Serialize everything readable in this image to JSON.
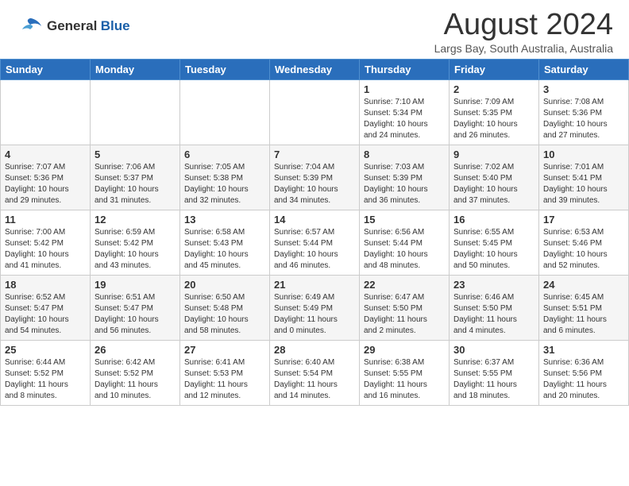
{
  "header": {
    "logo_general": "General",
    "logo_blue": "Blue",
    "month_title": "August 2024",
    "location": "Largs Bay, South Australia, Australia"
  },
  "weekdays": [
    "Sunday",
    "Monday",
    "Tuesday",
    "Wednesday",
    "Thursday",
    "Friday",
    "Saturday"
  ],
  "weeks": [
    [
      {
        "day": "",
        "info": ""
      },
      {
        "day": "",
        "info": ""
      },
      {
        "day": "",
        "info": ""
      },
      {
        "day": "",
        "info": ""
      },
      {
        "day": "1",
        "info": "Sunrise: 7:10 AM\nSunset: 5:34 PM\nDaylight: 10 hours\nand 24 minutes."
      },
      {
        "day": "2",
        "info": "Sunrise: 7:09 AM\nSunset: 5:35 PM\nDaylight: 10 hours\nand 26 minutes."
      },
      {
        "day": "3",
        "info": "Sunrise: 7:08 AM\nSunset: 5:36 PM\nDaylight: 10 hours\nand 27 minutes."
      }
    ],
    [
      {
        "day": "4",
        "info": "Sunrise: 7:07 AM\nSunset: 5:36 PM\nDaylight: 10 hours\nand 29 minutes."
      },
      {
        "day": "5",
        "info": "Sunrise: 7:06 AM\nSunset: 5:37 PM\nDaylight: 10 hours\nand 31 minutes."
      },
      {
        "day": "6",
        "info": "Sunrise: 7:05 AM\nSunset: 5:38 PM\nDaylight: 10 hours\nand 32 minutes."
      },
      {
        "day": "7",
        "info": "Sunrise: 7:04 AM\nSunset: 5:39 PM\nDaylight: 10 hours\nand 34 minutes."
      },
      {
        "day": "8",
        "info": "Sunrise: 7:03 AM\nSunset: 5:39 PM\nDaylight: 10 hours\nand 36 minutes."
      },
      {
        "day": "9",
        "info": "Sunrise: 7:02 AM\nSunset: 5:40 PM\nDaylight: 10 hours\nand 37 minutes."
      },
      {
        "day": "10",
        "info": "Sunrise: 7:01 AM\nSunset: 5:41 PM\nDaylight: 10 hours\nand 39 minutes."
      }
    ],
    [
      {
        "day": "11",
        "info": "Sunrise: 7:00 AM\nSunset: 5:42 PM\nDaylight: 10 hours\nand 41 minutes."
      },
      {
        "day": "12",
        "info": "Sunrise: 6:59 AM\nSunset: 5:42 PM\nDaylight: 10 hours\nand 43 minutes."
      },
      {
        "day": "13",
        "info": "Sunrise: 6:58 AM\nSunset: 5:43 PM\nDaylight: 10 hours\nand 45 minutes."
      },
      {
        "day": "14",
        "info": "Sunrise: 6:57 AM\nSunset: 5:44 PM\nDaylight: 10 hours\nand 46 minutes."
      },
      {
        "day": "15",
        "info": "Sunrise: 6:56 AM\nSunset: 5:44 PM\nDaylight: 10 hours\nand 48 minutes."
      },
      {
        "day": "16",
        "info": "Sunrise: 6:55 AM\nSunset: 5:45 PM\nDaylight: 10 hours\nand 50 minutes."
      },
      {
        "day": "17",
        "info": "Sunrise: 6:53 AM\nSunset: 5:46 PM\nDaylight: 10 hours\nand 52 minutes."
      }
    ],
    [
      {
        "day": "18",
        "info": "Sunrise: 6:52 AM\nSunset: 5:47 PM\nDaylight: 10 hours\nand 54 minutes."
      },
      {
        "day": "19",
        "info": "Sunrise: 6:51 AM\nSunset: 5:47 PM\nDaylight: 10 hours\nand 56 minutes."
      },
      {
        "day": "20",
        "info": "Sunrise: 6:50 AM\nSunset: 5:48 PM\nDaylight: 10 hours\nand 58 minutes."
      },
      {
        "day": "21",
        "info": "Sunrise: 6:49 AM\nSunset: 5:49 PM\nDaylight: 11 hours\nand 0 minutes."
      },
      {
        "day": "22",
        "info": "Sunrise: 6:47 AM\nSunset: 5:50 PM\nDaylight: 11 hours\nand 2 minutes."
      },
      {
        "day": "23",
        "info": "Sunrise: 6:46 AM\nSunset: 5:50 PM\nDaylight: 11 hours\nand 4 minutes."
      },
      {
        "day": "24",
        "info": "Sunrise: 6:45 AM\nSunset: 5:51 PM\nDaylight: 11 hours\nand 6 minutes."
      }
    ],
    [
      {
        "day": "25",
        "info": "Sunrise: 6:44 AM\nSunset: 5:52 PM\nDaylight: 11 hours\nand 8 minutes."
      },
      {
        "day": "26",
        "info": "Sunrise: 6:42 AM\nSunset: 5:52 PM\nDaylight: 11 hours\nand 10 minutes."
      },
      {
        "day": "27",
        "info": "Sunrise: 6:41 AM\nSunset: 5:53 PM\nDaylight: 11 hours\nand 12 minutes."
      },
      {
        "day": "28",
        "info": "Sunrise: 6:40 AM\nSunset: 5:54 PM\nDaylight: 11 hours\nand 14 minutes."
      },
      {
        "day": "29",
        "info": "Sunrise: 6:38 AM\nSunset: 5:55 PM\nDaylight: 11 hours\nand 16 minutes."
      },
      {
        "day": "30",
        "info": "Sunrise: 6:37 AM\nSunset: 5:55 PM\nDaylight: 11 hours\nand 18 minutes."
      },
      {
        "day": "31",
        "info": "Sunrise: 6:36 AM\nSunset: 5:56 PM\nDaylight: 11 hours\nand 20 minutes."
      }
    ]
  ]
}
